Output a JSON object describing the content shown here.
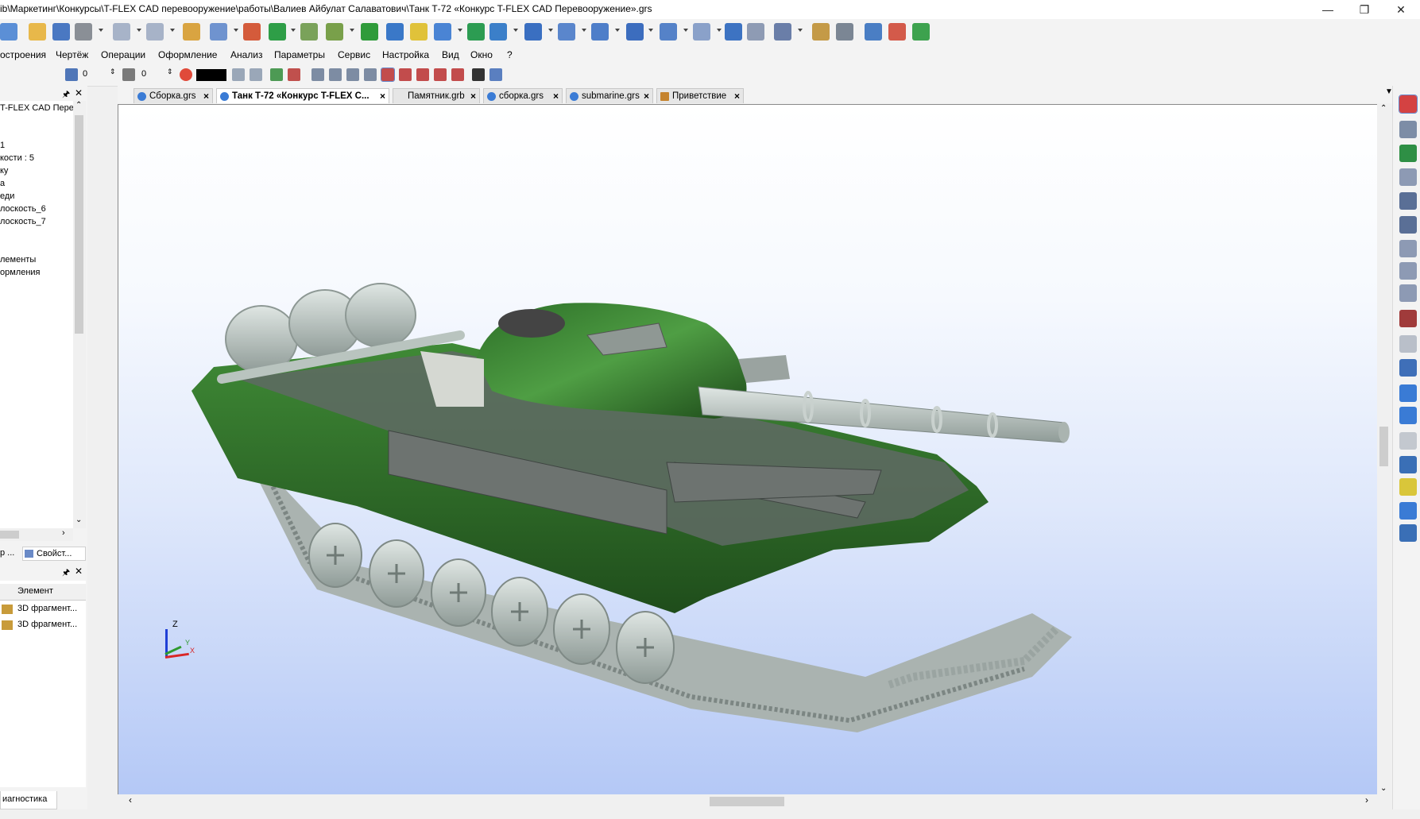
{
  "window": {
    "title": "ib\\Маркетинг\\Конкурсы\\T-FLEX CAD перевооружение\\работы\\Валиев Айбулат Салаватович\\Танк Т-72 «Конкурс T-FLEX CAD Перевооружение».grs",
    "minimize": "—",
    "restore": "❐",
    "close": "✕"
  },
  "menu": [
    "остроения",
    "Чертёж",
    "Операции",
    "Оформление",
    "Анализ",
    "Параметры",
    "Сервис",
    "Настройка",
    "Вид",
    "Окно",
    "?"
  ],
  "toolbar2": {
    "layer_value": "0",
    "level_value": "0",
    "color": "#000000"
  },
  "tree_panel": {
    "header_title": "T-FLEX CAD Перев",
    "items": [
      "1",
      "кости : 5",
      "ку",
      "а",
      "еди",
      "лоскость_6",
      "лоскость_7",
      "лементы",
      "ормления"
    ]
  },
  "panel_tabs": {
    "left": "р ...",
    "right": "Свойст..."
  },
  "elements_panel": {
    "column": "Элемент",
    "rows": [
      "3D фрагмент...",
      "3D фрагмент..."
    ]
  },
  "bottom_tab": "иагностика",
  "doc_tabs": [
    {
      "label": "Сборка.grs",
      "active": false
    },
    {
      "label": "Танк Т-72 «Конкурс T-FLEX C...",
      "active": true
    },
    {
      "label": "Памятник.grb",
      "active": false
    },
    {
      "label": "сборка.grs",
      "active": false
    },
    {
      "label": "submarine.grs",
      "active": false
    },
    {
      "label": "Приветствие",
      "active": false
    }
  ],
  "axes": {
    "z": "Z",
    "y": "Y",
    "x": "X"
  },
  "colors": {
    "hull": "#2f6b2a",
    "steel": "#b9c4bf",
    "background_bottom": "#b4c8f6"
  }
}
